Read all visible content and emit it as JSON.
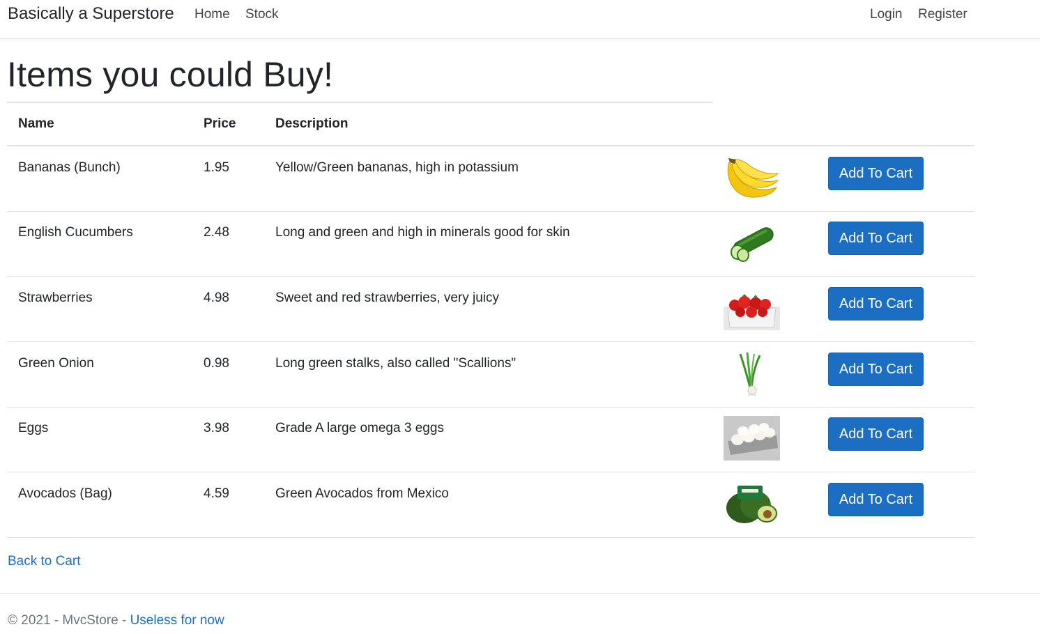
{
  "navbar": {
    "brand": "Basically a Superstore",
    "links": [
      "Home",
      "Stock"
    ],
    "login": "Login",
    "register": "Register"
  },
  "page": {
    "title": "Items you could Buy!"
  },
  "table": {
    "headers": [
      "Name",
      "Price",
      "Description"
    ],
    "rows": [
      {
        "name": "Bananas (Bunch)",
        "price": "1.95",
        "description": "Yellow/Green bananas, high in potassium",
        "image": "bananas-image",
        "button": "Add To Cart"
      },
      {
        "name": "English Cucumbers",
        "price": "2.48",
        "description": "Long and green and high in minerals good for skin",
        "image": "cucumber-image",
        "button": "Add To Cart"
      },
      {
        "name": "Strawberries",
        "price": "4.98",
        "description": "Sweet and red strawberries, very juicy",
        "image": "strawberries-image",
        "button": "Add To Cart"
      },
      {
        "name": "Green Onion",
        "price": "0.98",
        "description": "Long green stalks, also called \"Scallions\"",
        "image": "green-onion-image",
        "button": "Add To Cart"
      },
      {
        "name": "Eggs",
        "price": "3.98",
        "description": "Grade A large omega 3 eggs",
        "image": "eggs-image",
        "button": "Add To Cart"
      },
      {
        "name": "Avocados (Bag)",
        "price": "4.59",
        "description": "Green Avocados from Mexico",
        "image": "avocados-image",
        "button": "Add To Cart"
      }
    ]
  },
  "back_link": "Back to Cart",
  "footer": {
    "text": "© 2021 - MvcStore - ",
    "link": "Useless for now"
  },
  "colors": {
    "primary": "#1b6ec2",
    "text": "#212529",
    "muted": "#6c757d",
    "border": "#dee2e6"
  }
}
